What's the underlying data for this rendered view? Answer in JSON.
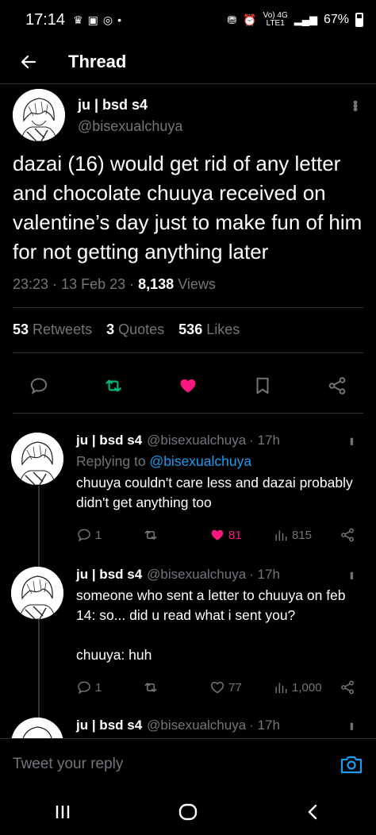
{
  "status_bar": {
    "time": "17:14",
    "network": "Vo) 4G",
    "network_sub": "LTE1",
    "battery": "67%"
  },
  "header": {
    "title": "Thread"
  },
  "main_tweet": {
    "display_name": "ju | bsd s4",
    "handle": "@bisexualchuya",
    "text": "dazai (16) would get rid of any letter and chocolate chuuya received on valentine’s day just to make fun of him for not getting anything later",
    "time": "23:23",
    "date": "13 Feb 23",
    "views_count": "8,138",
    "views_label": "Views",
    "retweets_count": "53",
    "retweets_label": "Retweets",
    "quotes_count": "3",
    "quotes_label": "Quotes",
    "likes_count": "536",
    "likes_label": "Likes",
    "like_color": "#f91880",
    "retweet_color": "#00ba7c"
  },
  "replies": [
    {
      "display_name": "ju | bsd s4",
      "handle": "@bisexualchuya",
      "age": "· 17h",
      "replying_label": "Replying to",
      "replying_handle": "@bisexualchuya",
      "text": "chuuya couldn't care less and dazai probably didn't get anything too",
      "reply_count": "1",
      "like_count": "81",
      "views_count": "815",
      "liked": true
    },
    {
      "display_name": "ju | bsd s4",
      "handle": "@bisexualchuya",
      "age": "· 17h",
      "text_line1": "someone who sent a letter to chuuya on feb 14: so... did u read what i sent you?",
      "text_line2": "chuuya: huh",
      "reply_count": "1",
      "like_count": "77",
      "views_count": "1,000",
      "liked": false
    },
    {
      "display_name": "ju | bsd s4",
      "handle": "@bisexualchuya",
      "age": "· 17h"
    }
  ],
  "composer": {
    "placeholder": "Tweet your reply"
  },
  "icons": {
    "back": "arrow-left-icon",
    "reply": "comment-icon",
    "retweet": "retweet-icon",
    "like": "heart-icon",
    "bookmark": "bookmark-icon",
    "share": "share-icon",
    "views": "views-bar-icon",
    "camera": "camera-icon"
  }
}
